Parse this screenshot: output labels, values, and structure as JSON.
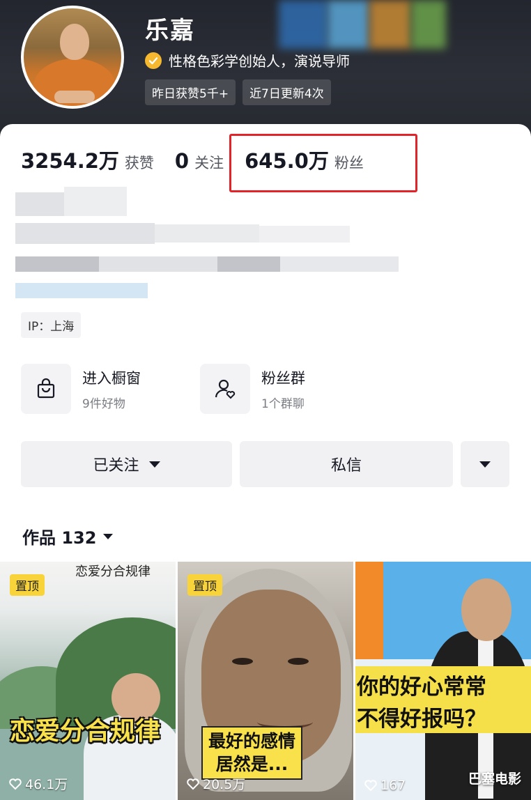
{
  "profile": {
    "name": "乐嘉",
    "verification": "性格色彩学创始人，演说导师",
    "chips": [
      "昨日获赞5千+",
      "近7日更新4次"
    ]
  },
  "stats": {
    "likes": {
      "value": "3254.2万",
      "label": "获赞"
    },
    "following": {
      "value": "0",
      "label": "关注"
    },
    "followers": {
      "value": "645.0万",
      "label": "粉丝"
    }
  },
  "ip": "IP：上海",
  "entries": {
    "shop": {
      "title": "进入橱窗",
      "subtitle": "9件好物",
      "icon": "shopping-bag-icon"
    },
    "fan_group": {
      "title": "粉丝群",
      "subtitle": "1个群聊",
      "icon": "user-heart-icon"
    }
  },
  "buttons": {
    "followed": "已关注",
    "message": "私信"
  },
  "works": {
    "label": "作品 132"
  },
  "videos": [
    {
      "pinned": "置顶",
      "title": "恋爱分合规律",
      "caption": "恋爱分合规律",
      "likes": "46.1万"
    },
    {
      "pinned": "置顶",
      "caption_line1": "最好的感情",
      "caption_line2": "居然是...",
      "likes": "20.5万"
    },
    {
      "caption_line1": "你的好心常常",
      "caption_line2": "不得好报吗？",
      "likes": "167"
    }
  ],
  "watermark": "巴塞电影",
  "colors": {
    "highlight_box": "#e0242a",
    "verify_badge": "#f5b82e",
    "caption_yellow": "#f8e14a"
  }
}
